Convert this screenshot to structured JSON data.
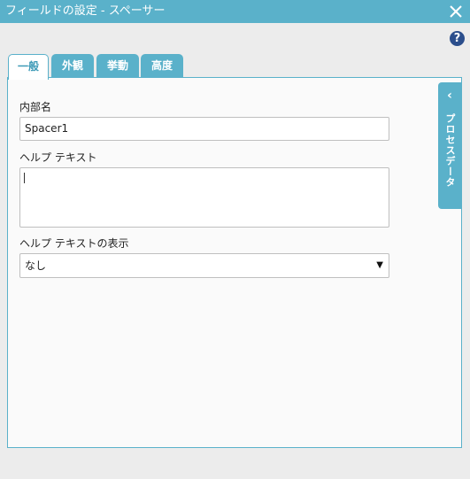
{
  "window": {
    "title": "フィールドの設定 - スペーサー",
    "close_icon": "close-icon",
    "help_icon": "help-icon",
    "help_label": "?"
  },
  "tabs": [
    {
      "label": "一般",
      "active": true
    },
    {
      "label": "外観",
      "active": false
    },
    {
      "label": "挙動",
      "active": false
    },
    {
      "label": "高度",
      "active": false
    }
  ],
  "form": {
    "internal_name_label": "内部名",
    "internal_name_value": "Spacer1",
    "help_text_label": "ヘルプ テキスト",
    "help_text_value": "",
    "help_display_label": "ヘルプ テキストの表示",
    "help_display_value": "なし"
  },
  "side_panel": {
    "label": "プロセスデータ",
    "chevron_icon": "chevron-left-icon"
  },
  "colors": {
    "accent": "#5ab1ca",
    "help_icon_bg": "#2b4e8c",
    "panel_bg": "#fafafa"
  }
}
